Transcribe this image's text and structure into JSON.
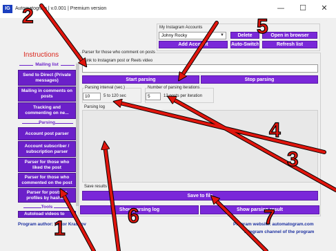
{
  "window": {
    "icon_text": "IG",
    "title": "Automatogram | v.0.001 | Premium version",
    "controls": [
      "—",
      "☐",
      "✕"
    ]
  },
  "accounts": {
    "group_label": "My Instagram Accounts",
    "selected": "Johny Rocky",
    "delete_label": "Delete",
    "open_browser_label": "Open in browser",
    "add_account_label": "Add Account",
    "auto_switch_label": "Auto-Switch",
    "refresh_label": "Refresh list"
  },
  "sidebar": {
    "title": "Instructions",
    "sections": {
      "mailing": "Mailing list",
      "parsing": "Parsing",
      "tools": "Tools"
    },
    "mailing_items": [
      "Send to Direct (Private messages)",
      "Mailing in comments on posts",
      "Tracking and commenting on ne..."
    ],
    "parsing_items": [
      "Account post parser",
      "Account subscriber / subscription parser",
      "Parser for those who liked the post",
      "Parser for those who commented on the post",
      "Parser for posts or profiles by hashtag"
    ],
    "tools_items": [
      "Autoload videos to"
    ]
  },
  "main": {
    "group_label": "Parser for those who comment on posts",
    "link_label": "Link to Instagram post or Reels video",
    "link_value": "",
    "start_label": "Start parsing",
    "stop_label": "Stop parsing",
    "interval_label": "Parsing interval (sec.)",
    "interval_value": "10",
    "interval_hint": "5 to 120 sec",
    "iterations_label": "Number of parsing iterations",
    "iterations_value": "5",
    "iterations_hint": "12 posts per iteration",
    "log_label": "Parsing log",
    "save_group_label": "Save results",
    "save_label": "Save to file",
    "show_log_label": "Show parsing log",
    "show_result_label": "Show parsing result"
  },
  "footer": {
    "author": "Program author: Victor Krasnov",
    "website": "Program website: automatogram.com",
    "telegram": "Telegram channel of the program"
  },
  "annotations": {
    "numbers": [
      "1",
      "2",
      "3",
      "4",
      "5",
      "6",
      "7"
    ],
    "color": "#e0150d"
  },
  "colors": {
    "accent": "#7a28d9",
    "sidebar_button": "#6b20c9",
    "title_red": "#d9261c",
    "footer_blue": "#1b2fa0"
  }
}
